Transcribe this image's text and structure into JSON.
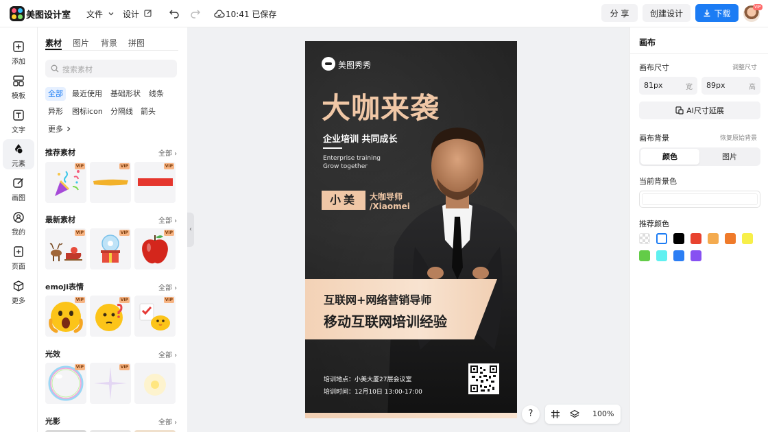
{
  "app": {
    "brand": "美图设计室"
  },
  "topbar": {
    "file_label": "文件",
    "design_label": "设计",
    "save_status": "10:41 已保存",
    "share_label": "分 享",
    "create_label": "创建设计",
    "download_label": "下载",
    "avatar_badge": "VIP"
  },
  "rail": {
    "items": [
      {
        "label": "添加",
        "icon": "plus-square-icon"
      },
      {
        "label": "模板",
        "icon": "template-grid-icon"
      },
      {
        "label": "文字",
        "icon": "text-icon"
      },
      {
        "label": "元素",
        "icon": "shapes-icon"
      },
      {
        "label": "画图",
        "icon": "pencil-edit-icon"
      },
      {
        "label": "我的",
        "icon": "user-icon"
      },
      {
        "label": "页面",
        "icon": "page-add-icon"
      },
      {
        "label": "更多",
        "icon": "cube-icon"
      }
    ]
  },
  "panel": {
    "tabs": [
      "素材",
      "图片",
      "背景",
      "拼图"
    ],
    "search_placeholder": "搜索素材",
    "chips": [
      "全部",
      "最近使用",
      "基础形状",
      "线条",
      "异形",
      "图标icon",
      "分隔线",
      "箭头",
      "更多"
    ],
    "all_label": "全部",
    "vip_badge": "VIP",
    "sections": [
      {
        "title": "推荐素材"
      },
      {
        "title": "最新素材"
      },
      {
        "title": "emoji表情"
      },
      {
        "title": "光效"
      },
      {
        "title": "光影"
      }
    ]
  },
  "poster": {
    "brand": "美图秀秀",
    "title": "大咖来袭",
    "subtitle": "企业培训 共同成长",
    "en_line1": "Enterprise training",
    "en_line2": "Grow together",
    "name": "小美",
    "role": "大咖导师",
    "role_en": "/Xiaomei",
    "banner_line1": "互联网+网络营销导师",
    "banner_line2": "移动互联网培训经验",
    "info_place": "培训地点：小美大厦27层会议室",
    "info_time": "培训时间：12月10日 13:00-17:00"
  },
  "bottombar": {
    "help": "?",
    "zoom": "100%"
  },
  "right": {
    "title": "画布",
    "size_label": "画布尺寸",
    "resize_link": "调整尺寸",
    "width_value": "81px",
    "width_unit": "宽",
    "height_value": "89px",
    "height_unit": "高",
    "ai_button": "AI尺寸延展",
    "bg_label": "画布背景",
    "restore_link": "恢复原始背景",
    "seg_color": "颜色",
    "seg_image": "图片",
    "current_bg_label": "当前背景色",
    "recommended_label": "推荐颜色",
    "colors": [
      "transparent",
      "#ffffff",
      "#000000",
      "#e8432f",
      "#f4ab4f",
      "#ef7a2a",
      "#f7ef49",
      "#63cc48",
      "#5ff0f0",
      "#2c7ef4",
      "#8751f2"
    ]
  },
  "colors": {
    "accent": "#1c7cf4",
    "poster_gold": "#f0c7a6"
  }
}
